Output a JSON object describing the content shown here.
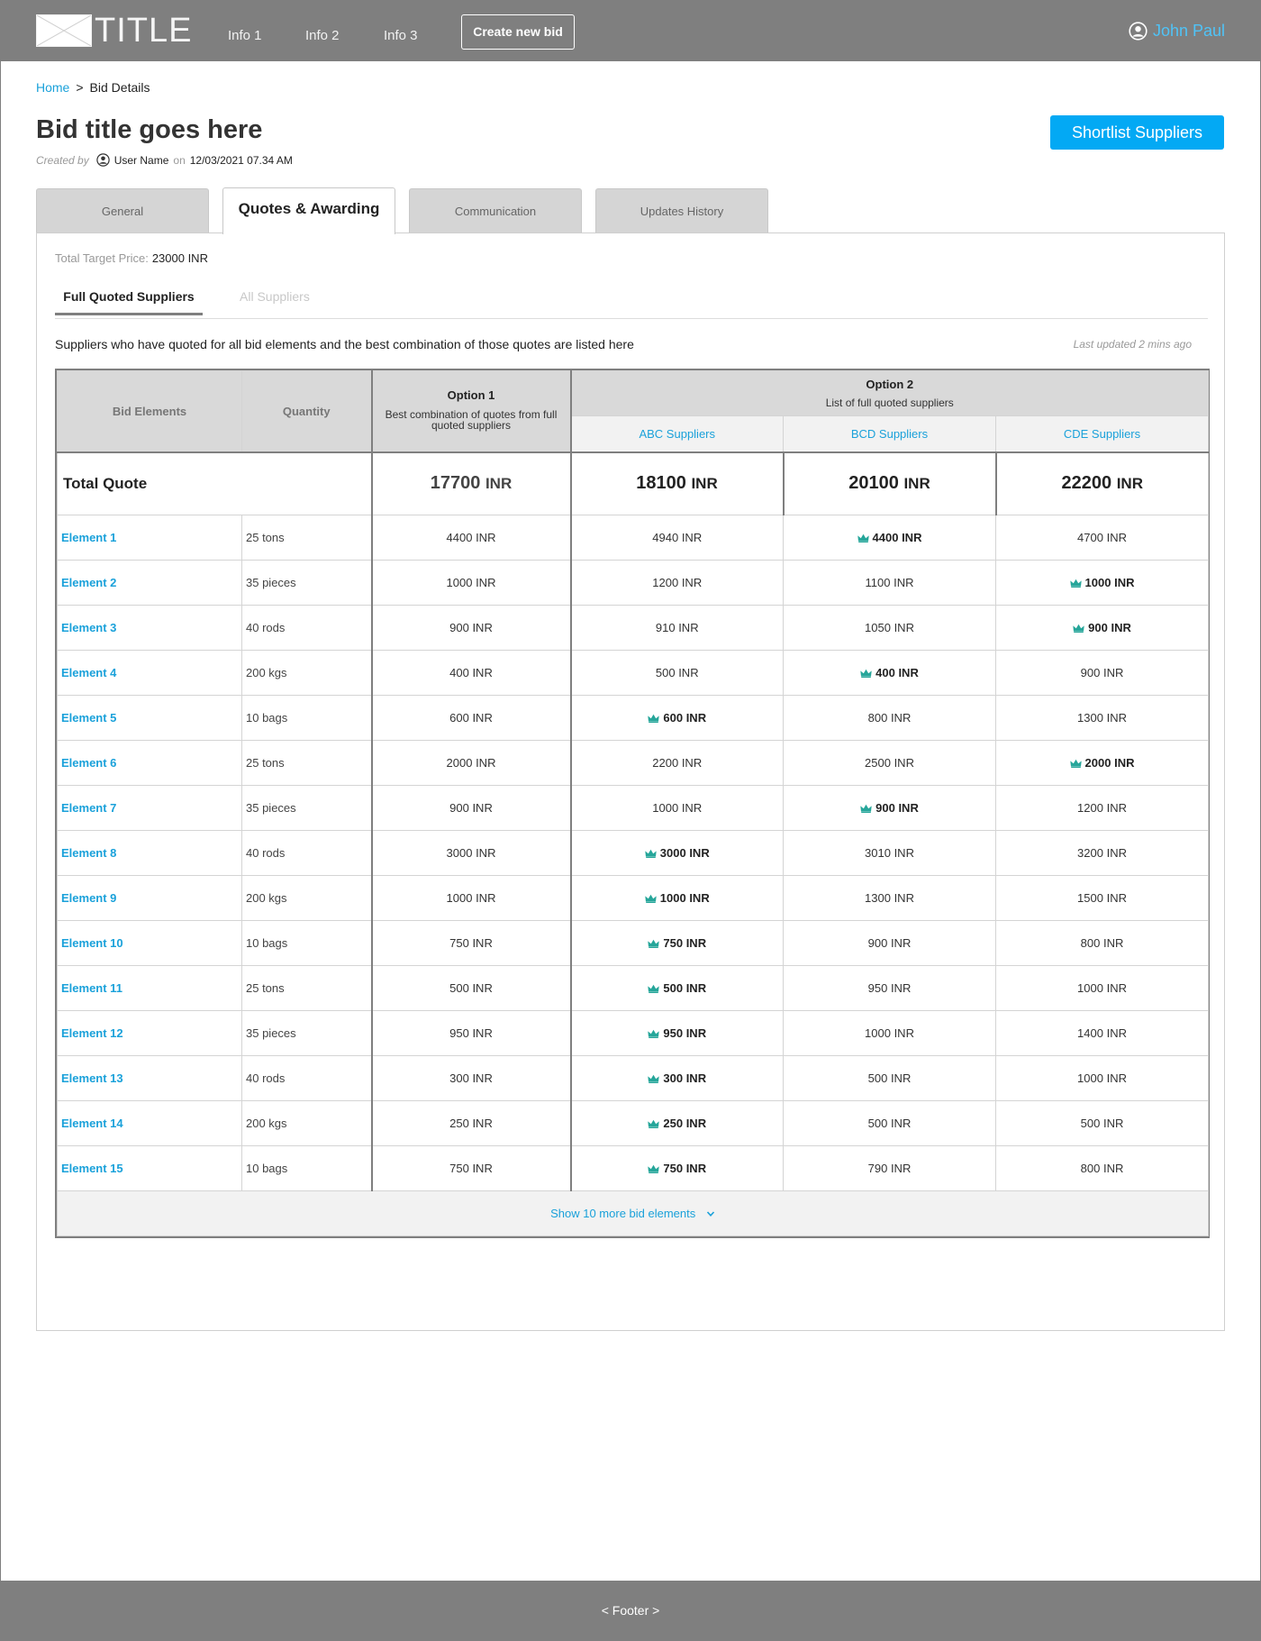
{
  "header": {
    "brand": "TITLE",
    "nav": [
      "Info 1",
      "Info 2",
      "Info 3"
    ],
    "create_button": "Create new bid",
    "user_name": "John Paul"
  },
  "breadcrumb": {
    "home": "Home",
    "separator": ">",
    "current": "Bid Details"
  },
  "page": {
    "title": "Bid title goes here",
    "created_by_label": "Created by",
    "user_name": "User Name",
    "on_label": "on",
    "timestamp": "12/03/2021 07.34 AM",
    "shortlist_button": "Shortlist Suppliers"
  },
  "tabs": [
    "General",
    "Quotes & Awarding",
    "Communication",
    "Updates History"
  ],
  "panel": {
    "target_label": "Total Target Price:",
    "target_value": "23000 INR",
    "subtabs": [
      "Full Quoted Suppliers",
      "All Suppliers"
    ],
    "description": "Suppliers who have quoted for all bid elements and the best combination of those quotes are listed here",
    "last_updated": "Last updated 2 mins ago"
  },
  "table": {
    "col_bid_elements": "Bid Elements",
    "col_quantity": "Quantity",
    "option1_title": "Option 1",
    "option1_sub": "Best combination of quotes from full quoted suppliers",
    "option2_title": "Option 2",
    "option2_sub": "List of full quoted suppliers",
    "suppliers": [
      "ABC Suppliers",
      "BCD Suppliers",
      "CDE Suppliers"
    ],
    "total_label": "Total Quote",
    "totals": [
      {
        "amount": "17700",
        "currency": "INR"
      },
      {
        "amount": "18100",
        "currency": "INR"
      },
      {
        "amount": "20100",
        "currency": "INR"
      },
      {
        "amount": "22200",
        "currency": "INR"
      }
    ],
    "rows": [
      {
        "name": "Element 1",
        "qty": "25 tons",
        "opt1": "4400 INR",
        "quotes": [
          "4940 INR",
          "4400 INR",
          "4700 INR"
        ],
        "best": 1
      },
      {
        "name": "Element 2",
        "qty": "35 pieces",
        "opt1": "1000 INR",
        "quotes": [
          "1200 INR",
          "1100 INR",
          "1000 INR"
        ],
        "best": 2
      },
      {
        "name": "Element 3",
        "qty": "40 rods",
        "opt1": "900 INR",
        "quotes": [
          "910 INR",
          "1050 INR",
          "900 INR"
        ],
        "best": 2
      },
      {
        "name": "Element 4",
        "qty": "200 kgs",
        "opt1": "400 INR",
        "quotes": [
          "500 INR",
          "400 INR",
          "900 INR"
        ],
        "best": 1
      },
      {
        "name": "Element 5",
        "qty": "10 bags",
        "opt1": "600 INR",
        "quotes": [
          "600 INR",
          "800 INR",
          "1300 INR"
        ],
        "best": 0
      },
      {
        "name": "Element 6",
        "qty": "25 tons",
        "opt1": "2000 INR",
        "quotes": [
          "2200 INR",
          "2500 INR",
          "2000 INR"
        ],
        "best": 2
      },
      {
        "name": "Element 7",
        "qty": "35 pieces",
        "opt1": "900 INR",
        "quotes": [
          "1000 INR",
          "900 INR",
          "1200 INR"
        ],
        "best": 1
      },
      {
        "name": "Element 8",
        "qty": "40 rods",
        "opt1": "3000 INR",
        "quotes": [
          "3000 INR",
          "3010 INR",
          "3200 INR"
        ],
        "best": 0
      },
      {
        "name": "Element 9",
        "qty": "200 kgs",
        "opt1": "1000 INR",
        "quotes": [
          "1000 INR",
          "1300 INR",
          "1500 INR"
        ],
        "best": 0
      },
      {
        "name": "Element 10",
        "qty": "10 bags",
        "opt1": "750 INR",
        "quotes": [
          "750 INR",
          "900 INR",
          "800 INR"
        ],
        "best": 0
      },
      {
        "name": "Element 11",
        "qty": "25 tons",
        "opt1": "500 INR",
        "quotes": [
          "500 INR",
          "950 INR",
          "1000 INR"
        ],
        "best": 0
      },
      {
        "name": "Element 12",
        "qty": "35 pieces",
        "opt1": "950 INR",
        "quotes": [
          "950 INR",
          "1000 INR",
          "1400 INR"
        ],
        "best": 0
      },
      {
        "name": "Element 13",
        "qty": "40 rods",
        "opt1": "300 INR",
        "quotes": [
          "300 INR",
          "500 INR",
          "1000 INR"
        ],
        "best": 0
      },
      {
        "name": "Element 14",
        "qty": "200 kgs",
        "opt1": "250 INR",
        "quotes": [
          "250 INR",
          "500 INR",
          "500 INR"
        ],
        "best": 0
      },
      {
        "name": "Element 15",
        "qty": "10 bags",
        "opt1": "750 INR",
        "quotes": [
          "750 INR",
          "790 INR",
          "800 INR"
        ],
        "best": 0
      }
    ],
    "show_more": "Show 10 more bid elements"
  },
  "footer": "< Footer >",
  "icons": {
    "logo": "image-placeholder-icon",
    "user": "user-circle-icon",
    "best": "crown-icon",
    "expand": "chevron-down-icon"
  },
  "colors": {
    "accent": "#1aa1da",
    "button": "#03a9f4",
    "header_bg": "#7f7f7f",
    "crown": "#26a69a"
  }
}
